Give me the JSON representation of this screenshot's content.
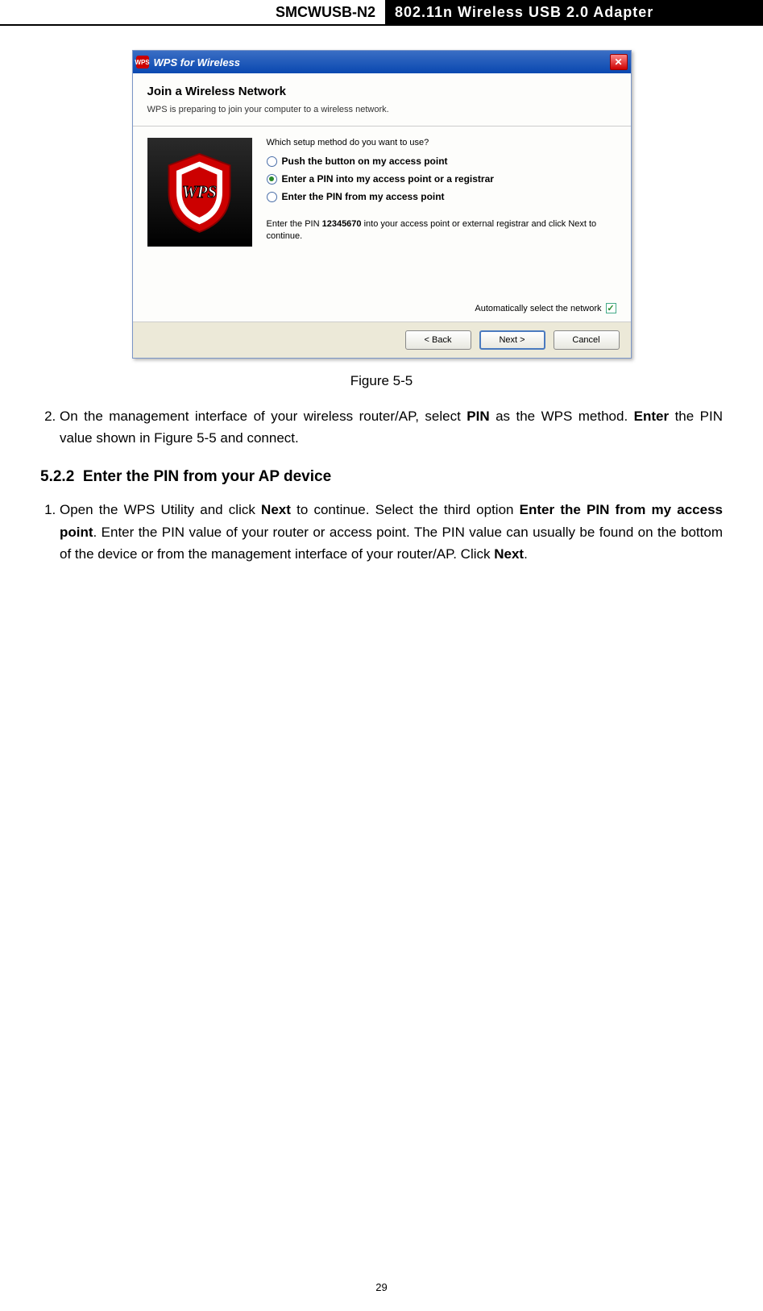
{
  "header": {
    "left": "SMCWUSB-N2",
    "right": "802.11n Wireless USB 2.0 Adapter"
  },
  "dialog": {
    "icon_label": "WPS",
    "title": "WPS for Wireless",
    "join_title": "Join a Wireless Network",
    "join_sub": "WPS is preparing to join your computer to a wireless network.",
    "setup_q": "Which setup method do you want to use?",
    "options": {
      "opt1": "Push the button on my access point",
      "opt2": "Enter a PIN into my access point or a registrar",
      "opt3": "Enter the PIN from my access point"
    },
    "pin_instr_pre": "Enter the PIN ",
    "pin_value": "12345670",
    "pin_instr_post": " into your access point or external registrar and click Next to continue.",
    "auto_label": "Automatically select the network",
    "btn_back": "< Back",
    "btn_next": "Next >",
    "btn_cancel": "Cancel",
    "wps_logo_text": "WPS"
  },
  "figure": "Figure 5-5",
  "step2_pre": "On the management interface of your wireless router/AP, select ",
  "step2_b1": "PIN",
  "step2_mid": " as the WPS method. ",
  "step2_b2": "Enter",
  "step2_post": " the PIN value shown in Figure 5-5 and connect.",
  "section_num": "5.2.2",
  "section_title": "Enter the PIN from your AP device",
  "step1_pre": "Open the WPS Utility and click ",
  "step1_b1": "Next",
  "step1_mid1": " to continue. Select the third option ",
  "step1_b2": "Enter the PIN from my access point",
  "step1_mid2": ". Enter the PIN value of your router or access point. The PIN value can usually be found on the bottom of the device or from the management interface of your router/AP. Click ",
  "step1_b3": "Next",
  "step1_post": ".",
  "page_number": "29"
}
